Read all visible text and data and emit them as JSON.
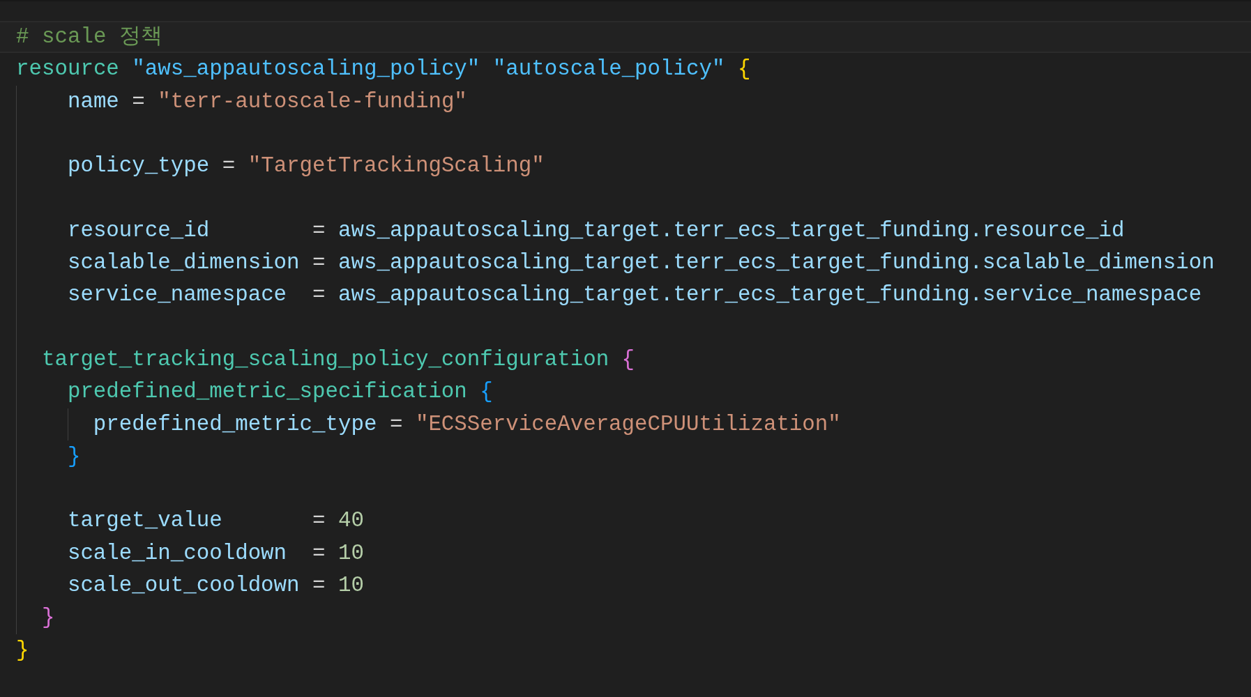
{
  "lines": [
    {
      "kind": "line",
      "highlighted": true,
      "tokens": [
        {
          "kind": "comment",
          "text": "# scale 정책"
        }
      ]
    },
    {
      "kind": "block",
      "guide": true,
      "open": [
        {
          "kind": "keyword",
          "text": "resource"
        },
        {
          "kind": "label",
          "text": " \"aws_appautoscaling_policy\""
        },
        {
          "kind": "label",
          "text": " \"autoscale_policy\""
        },
        {
          "kind": "bracket",
          "color": "#ffd700",
          "text": " {"
        }
      ],
      "children": [
        {
          "kind": "line",
          "highlighted": false,
          "tokens": [
            {
              "kind": "property",
              "text": "  name"
            },
            {
              "kind": "operator",
              "text": " = "
            },
            {
              "kind": "string",
              "text": "\"terr-autoscale-funding\""
            }
          ]
        },
        {
          "kind": "blank"
        },
        {
          "kind": "line",
          "highlighted": false,
          "tokens": [
            {
              "kind": "property",
              "text": "  policy_type"
            },
            {
              "kind": "operator",
              "text": " = "
            },
            {
              "kind": "string",
              "text": "\"TargetTrackingScaling\""
            }
          ]
        },
        {
          "kind": "blank"
        },
        {
          "kind": "line",
          "highlighted": false,
          "tokens": [
            {
              "kind": "property",
              "text": "  resource_id"
            },
            {
              "kind": "operator",
              "text": "        = "
            },
            {
              "kind": "reference",
              "text": "aws_appautoscaling_target.terr_ecs_target_funding.resource_id"
            }
          ]
        },
        {
          "kind": "line",
          "highlighted": false,
          "tokens": [
            {
              "kind": "property",
              "text": "  scalable_dimension"
            },
            {
              "kind": "operator",
              "text": " = "
            },
            {
              "kind": "reference",
              "text": "aws_appautoscaling_target.terr_ecs_target_funding.scalable_dimension"
            }
          ]
        },
        {
          "kind": "line",
          "highlighted": false,
          "tokens": [
            {
              "kind": "property",
              "text": "  service_namespace"
            },
            {
              "kind": "operator",
              "text": "  = "
            },
            {
              "kind": "reference",
              "text": "aws_appautoscaling_target.terr_ecs_target_funding.service_namespace"
            }
          ]
        },
        {
          "kind": "blank"
        },
        {
          "kind": "block",
          "guide": false,
          "open": [
            {
              "kind": "keyword",
              "text": "target_tracking_scaling_policy_configuration"
            },
            {
              "kind": "bracket",
              "color": "#da70d6",
              "text": " {"
            }
          ],
          "children": [
            {
              "kind": "block",
              "guide": true,
              "open": [
                {
                  "kind": "keyword",
                  "text": "predefined_metric_specification"
                },
                {
                  "kind": "bracket",
                  "color": "#179fff",
                  "text": " {"
                }
              ],
              "children": [
                {
                  "kind": "line",
                  "highlighted": false,
                  "tokens": [
                    {
                      "kind": "property",
                      "text": "predefined_metric_type"
                    },
                    {
                      "kind": "operator",
                      "text": " = "
                    },
                    {
                      "kind": "string",
                      "text": "\"ECSServiceAverageCPUUtilization\""
                    }
                  ]
                }
              ],
              "close": [
                {
                  "kind": "bracket",
                  "color": "#179fff",
                  "text": "}"
                }
              ]
            },
            {
              "kind": "blank"
            },
            {
              "kind": "line",
              "highlighted": false,
              "tokens": [
                {
                  "kind": "property",
                  "text": "target_value"
                },
                {
                  "kind": "operator",
                  "text": "       = "
                },
                {
                  "kind": "number",
                  "text": "40"
                }
              ]
            },
            {
              "kind": "line",
              "highlighted": false,
              "tokens": [
                {
                  "kind": "property",
                  "text": "scale_in_cooldown"
                },
                {
                  "kind": "operator",
                  "text": "  = "
                },
                {
                  "kind": "number",
                  "text": "10"
                }
              ]
            },
            {
              "kind": "line",
              "highlighted": false,
              "tokens": [
                {
                  "kind": "property",
                  "text": "scale_out_cooldown"
                },
                {
                  "kind": "operator",
                  "text": " = "
                },
                {
                  "kind": "number",
                  "text": "10"
                }
              ]
            }
          ],
          "close": [
            {
              "kind": "bracket",
              "color": "#da70d6",
              "text": "}"
            }
          ]
        }
      ],
      "close": [
        {
          "kind": "bracket",
          "color": "#ffd700",
          "text": "}"
        }
      ]
    }
  ]
}
